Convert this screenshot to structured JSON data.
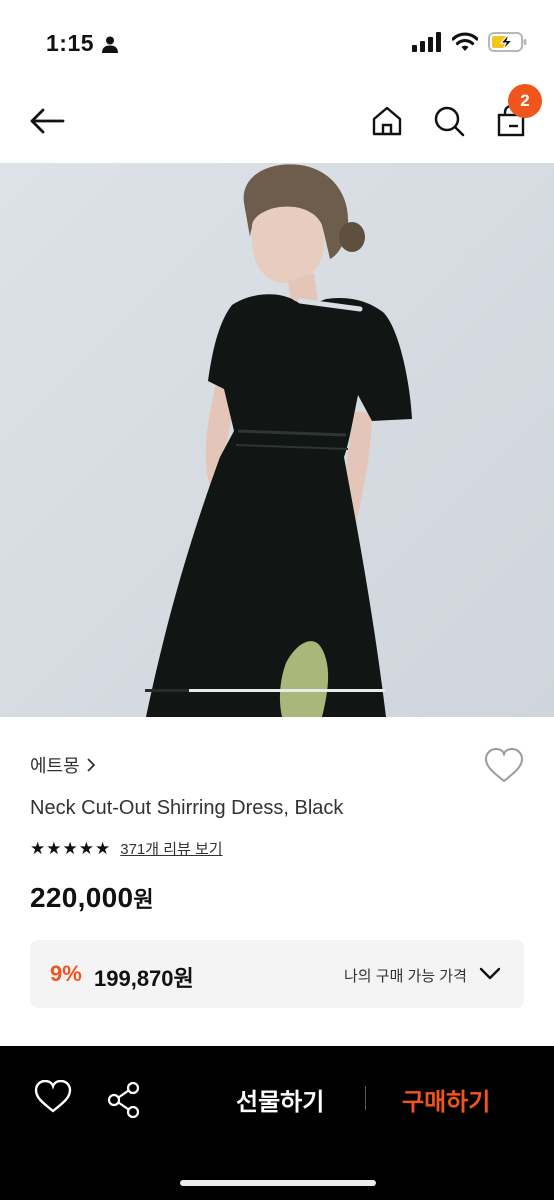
{
  "status_bar": {
    "time": "1:15",
    "icons": [
      "person-icon",
      "signal-icon",
      "wifi-icon",
      "battery-charging-icon"
    ]
  },
  "nav": {
    "icons": [
      "back-arrow-icon",
      "home-icon",
      "search-icon",
      "shopping-bag-icon"
    ],
    "cart_count": "2"
  },
  "hero": {
    "image_index": 1,
    "image_total": 6
  },
  "product": {
    "brand": "에트몽",
    "title": "Neck Cut-Out Shirring Dress, Black",
    "rating_stars": 5,
    "review_link": "371개 리뷰 보기",
    "price": "220,000",
    "price_unit": "원"
  },
  "discount": {
    "rate": "9%",
    "price": "199,870원",
    "label": "나의 구매 가능 가격"
  },
  "bottom_bar": {
    "gift_label": "선물하기",
    "buy_label": "구매하기"
  },
  "colors": {
    "accent": "#f0561b",
    "bottom_bar_bg": "#000000",
    "discount_box_bg": "#f4f4f5"
  }
}
